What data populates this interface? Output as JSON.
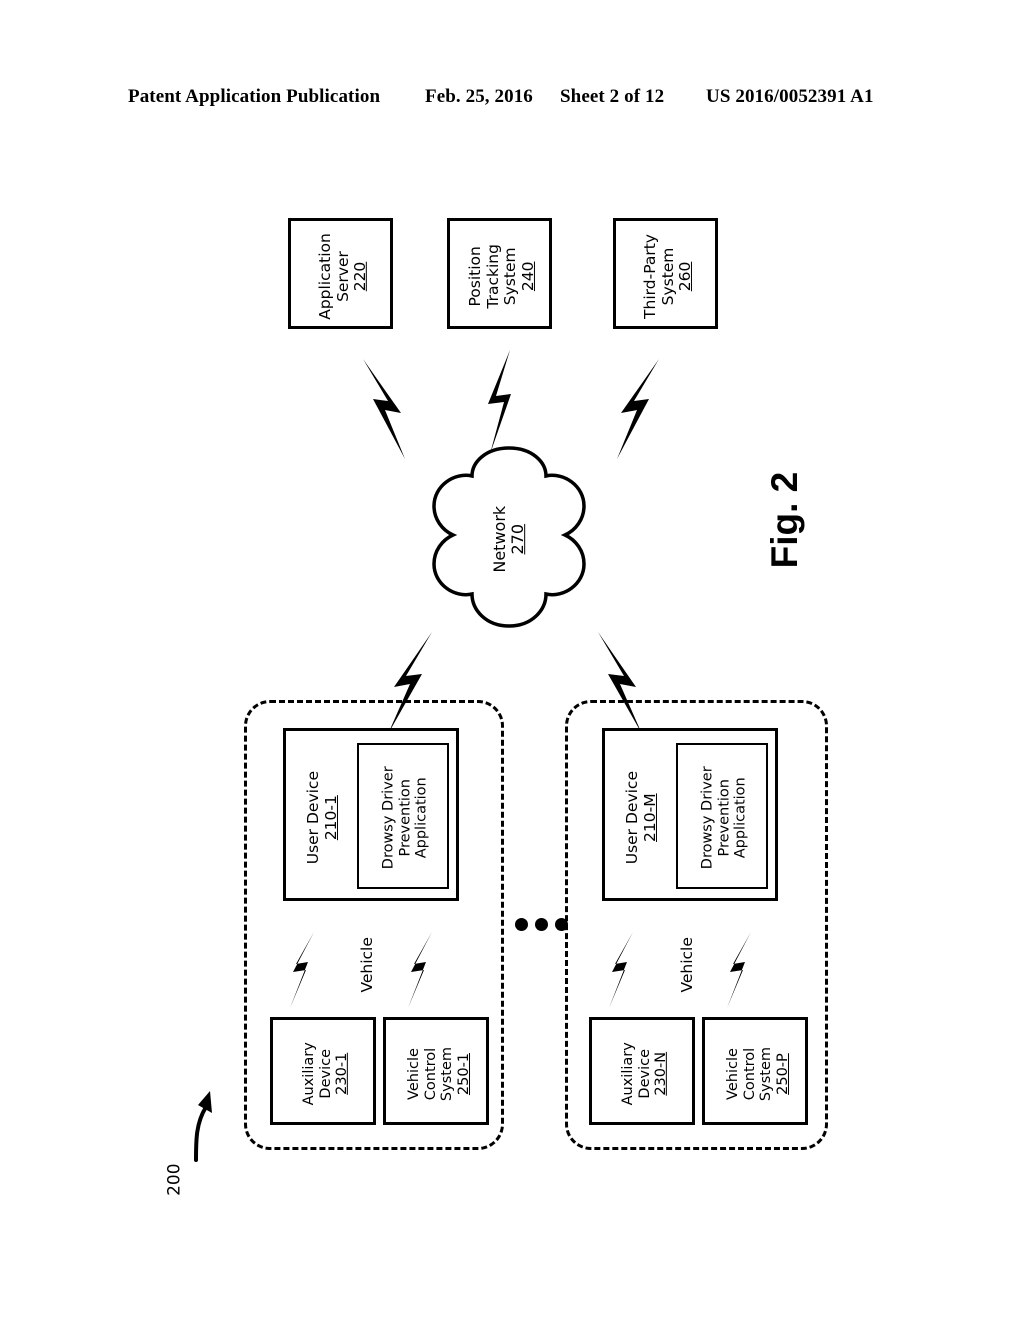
{
  "header": {
    "publication": "Patent Application Publication",
    "date": "Feb. 25, 2016",
    "sheet": "Sheet 2 of 12",
    "patent_number": "US 2016/0052391 A1"
  },
  "figure": {
    "label": "Fig. 2",
    "reference_numeral": "200"
  },
  "top_systems": [
    {
      "name": "application-server",
      "line1": "Application",
      "line2": "Server",
      "line3": "",
      "number": "220"
    },
    {
      "name": "position-tracking-system",
      "line1": "Position",
      "line2": "Tracking",
      "line3": "System",
      "number": "240"
    },
    {
      "name": "third-party-system",
      "line1": "Third-Party",
      "line2": "System",
      "line3": "",
      "number": "260"
    }
  ],
  "network": {
    "label": "Network",
    "number": "270"
  },
  "vehicles": [
    {
      "group_label": "Vehicle",
      "user_device": {
        "label": "User Device",
        "number": "210-1"
      },
      "application": {
        "line1": "Drowsy Driver",
        "line2": "Prevention",
        "line3": "Application"
      },
      "auxiliary_device": {
        "line1": "Auxiliary",
        "line2": "Device",
        "number": "230-1"
      },
      "vehicle_control_system": {
        "line1": "Vehicle",
        "line2": "Control",
        "line3": "System",
        "number": "250-1"
      }
    },
    {
      "group_label": "Vehicle",
      "user_device": {
        "label": "User Device",
        "number": "210-M"
      },
      "application": {
        "line1": "Drowsy Driver",
        "line2": "Prevention",
        "line3": "Application"
      },
      "auxiliary_device": {
        "line1": "Auxiliary",
        "line2": "Device",
        "number": "230-N"
      },
      "vehicle_control_system": {
        "line1": "Vehicle",
        "line2": "Control",
        "line3": "System",
        "number": "250-P"
      }
    }
  ],
  "ellipsis": "•••",
  "colors": {
    "ink": "#000000",
    "paper": "#ffffff"
  }
}
